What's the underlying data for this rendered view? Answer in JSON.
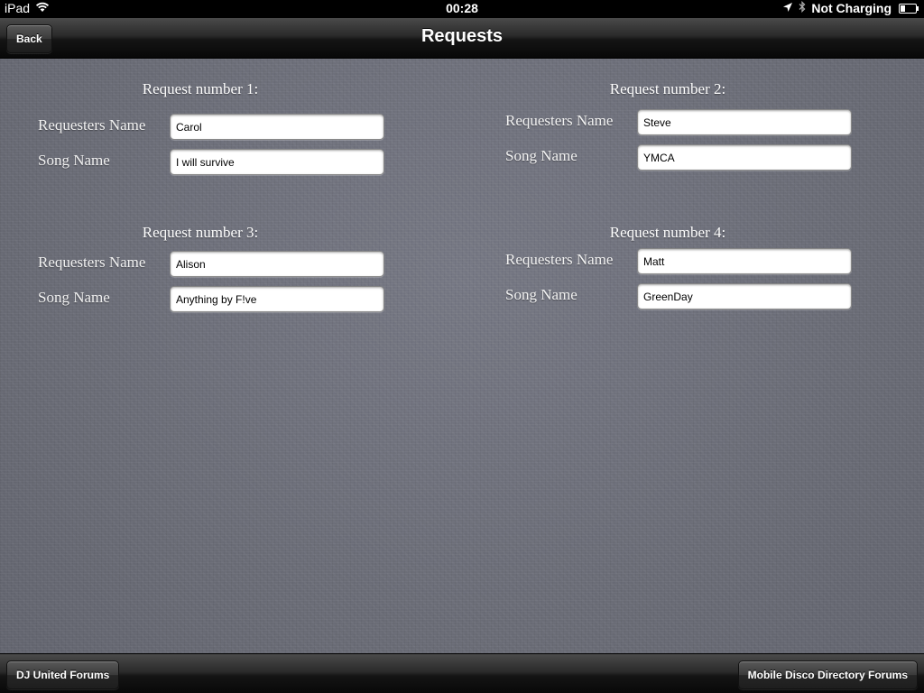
{
  "status_bar": {
    "carrier": "iPad",
    "time": "00:28",
    "charging": "Not Charging"
  },
  "nav": {
    "back_label": "Back",
    "title": "Requests"
  },
  "labels": {
    "requester": "Requesters Name",
    "song": "Song Name"
  },
  "requests": [
    {
      "title": "Request number 1:",
      "requester": "Carol",
      "song": "I will survive"
    },
    {
      "title": "Request number 2:",
      "requester": "Steve",
      "song": "YMCA"
    },
    {
      "title": "Request number 3:",
      "requester": "Alison",
      "song": "Anything by F!ve"
    },
    {
      "title": "Request number 4:",
      "requester": "Matt",
      "song": "GreenDay"
    }
  ],
  "toolbar": {
    "left_label": "DJ United Forums",
    "right_label": "Mobile Disco Directory Forums"
  }
}
